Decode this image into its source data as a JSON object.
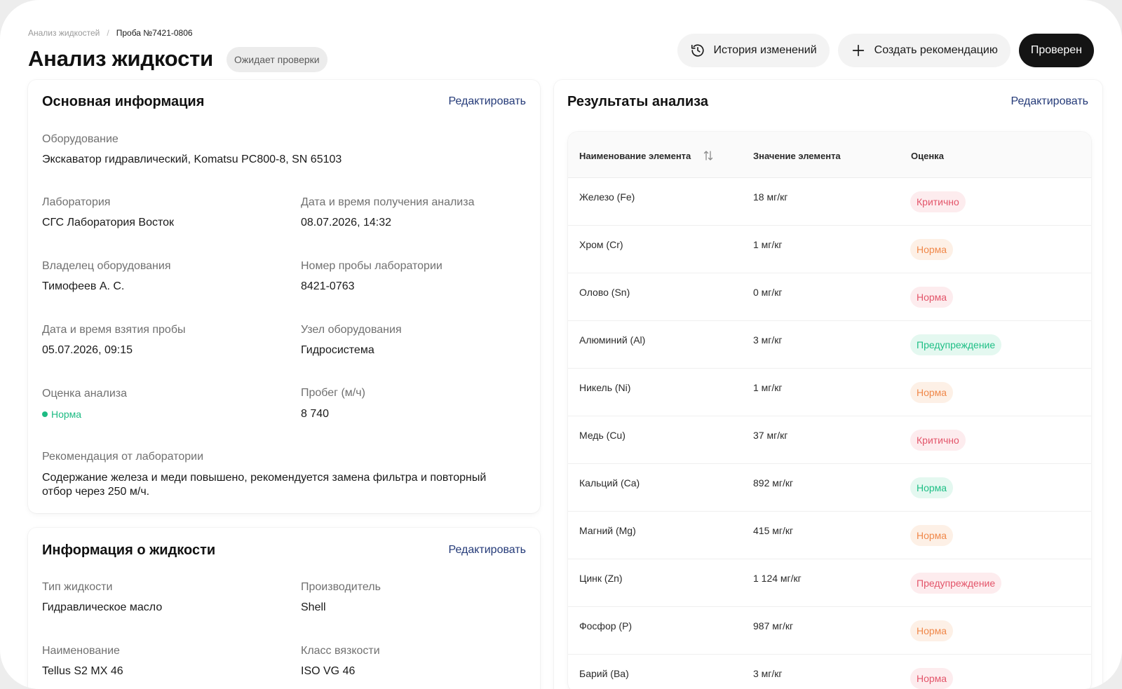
{
  "breadcrumb": {
    "parent": "Анализ жидкостей",
    "separator": "/",
    "current": "Проба №7421-0806"
  },
  "page": {
    "title": "Анализ жидкости",
    "status": "Ожидает проверки"
  },
  "actions": {
    "history": "История изменений",
    "create": "Создать рекомендацию",
    "verified": "Проверен"
  },
  "main_info": {
    "title": "Основная информация",
    "edit": "Редактировать",
    "equipment_label": "Оборудование",
    "equipment": "Экскаватор гидравлический, Komatsu PC800-8, SN 65103",
    "lab_label": "Лаборатория",
    "lab": "СГС Лаборатория Восток",
    "received_label": "Дата и время получения анализа",
    "received": "08.07.2026, 14:32",
    "owner_label": "Владелец оборудования",
    "owner": "Тимофеев А. С.",
    "lab_sample_label": "Номер пробы лаборатории",
    "lab_sample": "8421-0763",
    "sampled_label": "Дата и время взятия пробы",
    "sampled": "05.07.2026, 09:15",
    "unit_label": "Узел оборудования",
    "unit": "Гидросистема",
    "assessment_label": "Оценка анализа",
    "assessment": "Норма",
    "mileage_label": "Пробег (м/ч)",
    "mileage": "8 740",
    "recommendation_label": "Рекомендация от лаборатории",
    "recommendation_line1": "Содержание железа и меди повышено, рекомендуется замена фильтра и повторный",
    "recommendation_line2": "отбор через 250 м/ч."
  },
  "fluid_info": {
    "title": "Информация о жидкости",
    "edit": "Редактировать",
    "type_label": "Тип жидкости",
    "type": "Гидравлическое масло",
    "maker_label": "Производитель",
    "maker": "Shell",
    "name_label": "Наименование",
    "name": "Tellus S2 MX 46",
    "viscosity_label": "Класс вязкости",
    "viscosity": "ISO VG 46"
  },
  "results": {
    "title": "Результаты анализа",
    "edit": "Редактировать",
    "columns": [
      "Наименование элемента",
      "Значение элемента",
      "Оценка"
    ],
    "rows": [
      {
        "name": "Железо (Fe)",
        "value": "18 мг/кг",
        "grade": "Критично"
      },
      {
        "name": "Хром (Cr)",
        "value": "1 мг/кг",
        "grade": "Норма"
      },
      {
        "name": "Олово (Sn)",
        "value": "0 мг/кг",
        "grade": "Норма"
      },
      {
        "name": "Алюминий (Al)",
        "value": "3 мг/кг",
        "grade": "Предупреждение"
      },
      {
        "name": "Никель (Ni)",
        "value": "1 мг/кг",
        "grade": "Норма"
      },
      {
        "name": "Медь (Cu)",
        "value": "37 мг/кг",
        "grade": "Критично"
      },
      {
        "name": "Кальций (Ca)",
        "value": "892 мг/кг",
        "grade": "Норма"
      },
      {
        "name": "Магний (Mg)",
        "value": "415 мг/кг",
        "grade": "Норма"
      },
      {
        "name": "Цинк (Zn)",
        "value": "1 124 мг/кг",
        "grade": "Предупреждение"
      },
      {
        "name": "Фосфор (P)",
        "value": "987 мг/кг",
        "grade": "Норма"
      },
      {
        "name": "Барий (Ba)",
        "value": "3 мг/кг",
        "grade": "Норма"
      }
    ]
  },
  "colors": {
    "primary_button": "#141414",
    "link": "#243a78",
    "critical": "#e3556a",
    "norm_orange": "#f0884a",
    "ok_green": "#1dbb83"
  }
}
